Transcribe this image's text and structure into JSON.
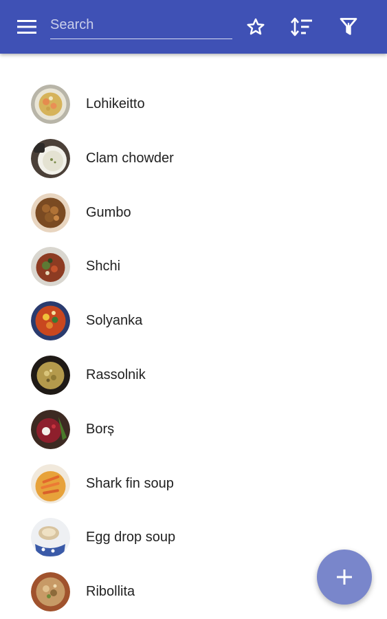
{
  "search": {
    "placeholder": "Search"
  },
  "toolbar": {
    "menu_icon": "menu-icon",
    "favorite_icon": "star-outline-icon",
    "sort_icon": "sort-icon",
    "filter_icon": "filter-icon"
  },
  "colors": {
    "app_bar": "#3f51b5",
    "fab": "#7986cb",
    "text": "#212121"
  },
  "recipes": [
    {
      "name": "Lohikeitto"
    },
    {
      "name": "Clam chowder"
    },
    {
      "name": "Gumbo"
    },
    {
      "name": "Shchi"
    },
    {
      "name": "Solyanka"
    },
    {
      "name": "Rassolnik"
    },
    {
      "name": "Borș"
    },
    {
      "name": "Shark fin soup"
    },
    {
      "name": "Egg drop soup"
    },
    {
      "name": "Ribollita"
    }
  ],
  "fab": {
    "icon": "plus-icon"
  }
}
